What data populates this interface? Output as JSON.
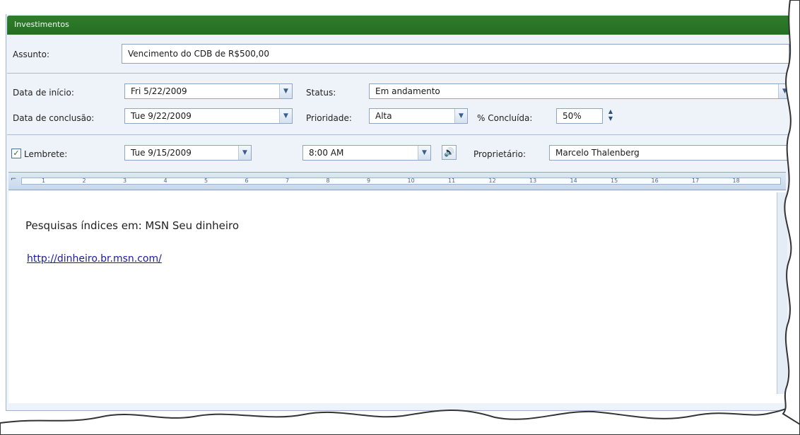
{
  "category": {
    "name": "Investimentos",
    "color": "#2f7d2c"
  },
  "subject": {
    "label": "Assunto:",
    "value": "Vencimento do CDB de R$500,00"
  },
  "start_date": {
    "label": "Data de início:",
    "value": "Fri 5/22/2009"
  },
  "due_date": {
    "label": "Data de conclusão:",
    "value": "Tue 9/22/2009"
  },
  "status": {
    "label": "Status:",
    "value": "Em andamento"
  },
  "priority": {
    "label": "Prioridade:",
    "value": "Alta"
  },
  "percent_complete": {
    "label": "% Concluída:",
    "value": "50%"
  },
  "reminder": {
    "label": "Lembrete:",
    "checked": true,
    "date": "Tue 9/15/2009",
    "time": "8:00 AM",
    "sound_icon": "speaker-icon"
  },
  "owner": {
    "label": "Proprietário:",
    "value": "Marcelo Thalenberg"
  },
  "ruler": {
    "ticks": [
      "1",
      "2",
      "3",
      "4",
      "5",
      "6",
      "7",
      "8",
      "9",
      "10",
      "11",
      "12",
      "13",
      "14",
      "15",
      "16",
      "17",
      "18"
    ]
  },
  "notes": {
    "text": "Pesquisas índices em: MSN Seu dinheiro",
    "link": "http://dinheiro.br.msn.com/"
  }
}
